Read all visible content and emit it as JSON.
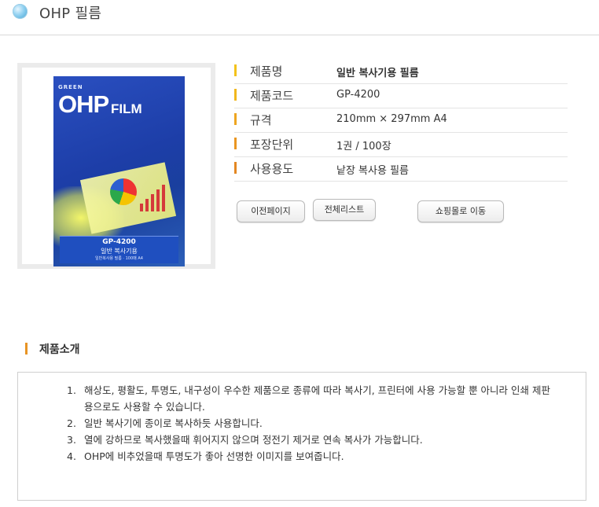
{
  "header": {
    "title": "OHP 필름"
  },
  "product_image": {
    "brand": "GREEN",
    "title_main": "OHP",
    "title_sub": "FILM",
    "code": "GP-4200",
    "subtitle": "일반 복사기용",
    "small_text": "일반복사용 필름",
    "bottom_text": "100매 A4",
    "colors": {
      "box": "#1d3ea8",
      "sheet": "#ecef7c"
    }
  },
  "specs": [
    {
      "label": "제품명",
      "value": "일반 복사기용 필름",
      "bar_color": "#f3c21b"
    },
    {
      "label": "제품코드",
      "value": "GP-4200",
      "bar_color": "#f1b71d"
    },
    {
      "label": "규격",
      "value": "210mm × 297mm A4",
      "bar_color": "#eea520"
    },
    {
      "label": "포장단위",
      "value": "1권 / 100장",
      "bar_color": "#ea9621"
    },
    {
      "label": "사용용도",
      "value": "낱장 복사용 필름",
      "bar_color": "#e38722"
    }
  ],
  "buttons": {
    "prev": "이전페이지",
    "list": "전체리스트",
    "mall": "쇼핑몰로 이동"
  },
  "intro": {
    "title": "제품소개",
    "items": [
      {
        "num": "1.",
        "text": "해상도, 평활도, 투명도, 내구성이 우수한 제품으로 종류에 따라 복사기, 프린터에 사용 가능할 뿐 아니라 인쇄 제판용으로도 사용할 수 있습니다."
      },
      {
        "num": "2.",
        "text": "일반 복사기에 종이로 복사하듯 사용합니다."
      },
      {
        "num": "3.",
        "text": "열에 강하므로 복사했을때 휘어지지 않으며 정전기 제거로 연속 복사가 가능합니다."
      },
      {
        "num": "4.",
        "text": "OHP에 비추었을때 투명도가 좋아 선명한 이미지를 보여줍니다."
      }
    ]
  }
}
